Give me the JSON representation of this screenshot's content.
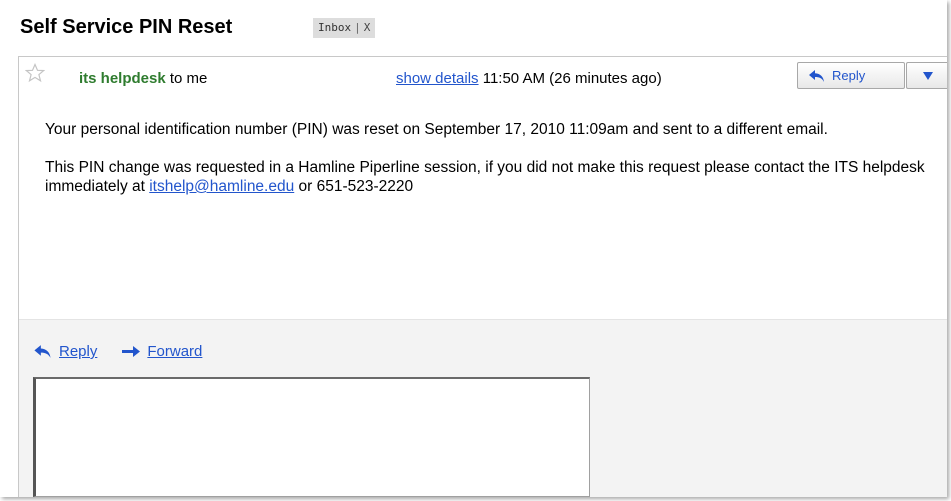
{
  "subject": "Self Service PIN Reset",
  "label": {
    "name": "Inbox",
    "separator": "|",
    "remove": "X"
  },
  "header": {
    "sender": "its helpdesk",
    "recipient_text": "to me",
    "show_details": "show details",
    "time": "11:50 AM (26 minutes ago)",
    "reply_label": "Reply"
  },
  "body": {
    "paragraph1": "Your personal identification number (PIN)  was reset on September 17, 2010 11:09am and sent to a different email.",
    "paragraph2_prefix": "This PIN change was requested in a Hamline Piperline session, if you did not make this request please contact the ITS helpdesk immediately at ",
    "email_link": "itshelp@hamline.edu",
    "paragraph2_suffix": " or 651-523-2220"
  },
  "footer": {
    "reply_label": "Reply",
    "forward_label": "Forward"
  },
  "colors": {
    "sender": "#2f7c2f",
    "link": "#2255cc",
    "reply_area_bg": "#f3f3f3"
  },
  "icons": {
    "star": "star-icon",
    "reply": "reply-arrow-icon",
    "forward": "forward-arrow-icon",
    "dropdown": "triangle-down-icon"
  }
}
